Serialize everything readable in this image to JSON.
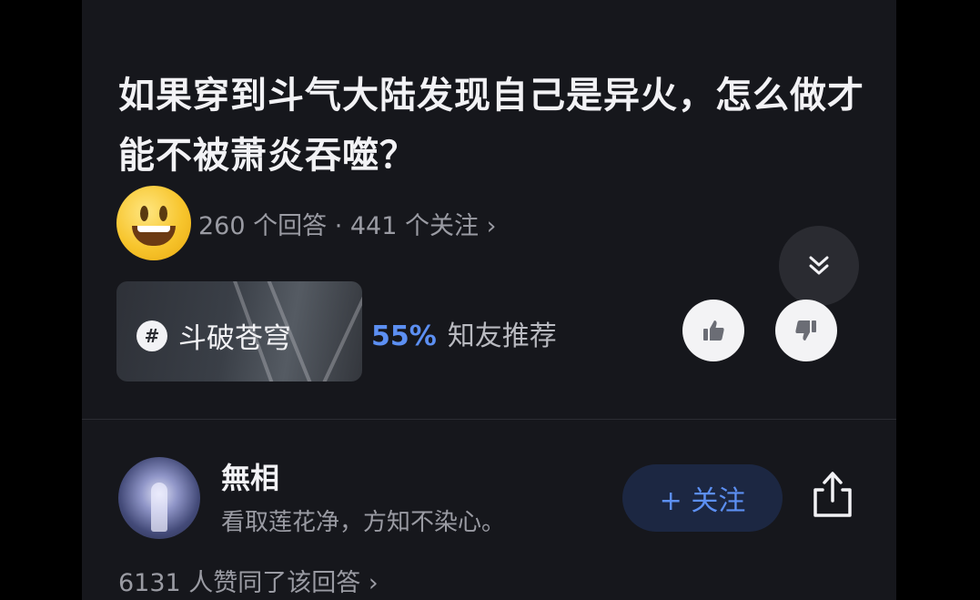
{
  "question": {
    "title": "如果穿到斗气大陆发现自己是异火，怎么做才能不被萧炎吞噬？",
    "meta": "260 个回答 · 441 个关注 ›"
  },
  "topic": {
    "label": "斗破苍穹",
    "percent": "55%",
    "rec_text": "知友推荐"
  },
  "answer": {
    "author_name": "無相",
    "author_bio": "看取莲花净，方知不染心。",
    "follow_label": "+ 关注",
    "agree_text": "6131 人赞同了该回答 ›"
  },
  "icons": [
    "smiley-emoji-icon",
    "double-chevron-down-icon",
    "hash-icon",
    "thumbs-up-icon",
    "thumbs-down-icon",
    "share-icon"
  ],
  "colors": {
    "background": "#16171c",
    "accent": "#5c8ff2",
    "muted_text": "#9a9ba3"
  }
}
